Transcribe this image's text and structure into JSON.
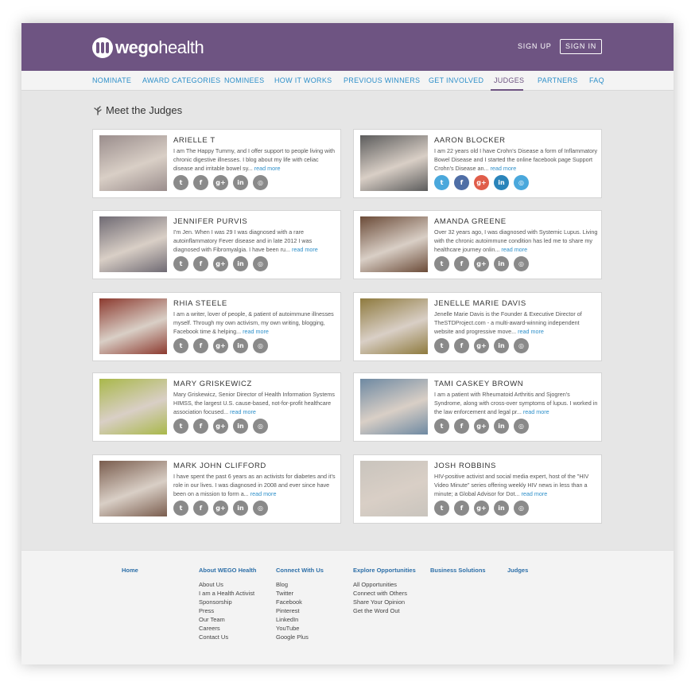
{
  "header": {
    "logo": {
      "bold": "wego",
      "light": "health"
    },
    "signup_label": "SIGN UP",
    "signin_label": "SIGN IN"
  },
  "nav": {
    "items": [
      {
        "label": "NOMINATE"
      },
      {
        "label": "AWARD CATEGORIES"
      },
      {
        "label": "NOMINEES"
      },
      {
        "label": "HOW IT WORKS"
      },
      {
        "label": "PREVIOUS WINNERS"
      },
      {
        "label": "GET INVOLVED"
      },
      {
        "label": "JUDGES"
      },
      {
        "label": "PARTNERS"
      },
      {
        "label": "FAQ"
      }
    ],
    "active": "JUDGES"
  },
  "page_title": "Meet the Judges",
  "read_more": "read more",
  "judges": [
    {
      "name": "ARIELLE T",
      "bio": "I am The Happy Tummy, and I offer support to people living with chronic digestive illnesses. I blog about my life with celiac disease and irritable bowel sy...",
      "photo": "#9a8d8c"
    },
    {
      "name": "AARON BLOCKER",
      "bio": "I am 22 years old I have Crohn's Disease a form of Inflammatory Bowel Disease and I started the online facebook page Support Crohn's Disease an...",
      "photo": "#5c5c5c"
    },
    {
      "name": "JENNIFER PURVIS",
      "bio": "I'm Jen. When I was 29 I was diagnosed with a rare autoinflammatory Fever disease and in late 2012 I was diagnosed with Fibromyalgia. I have been ru...",
      "photo": "#6f6a73"
    },
    {
      "name": "AMANDA GREENE",
      "bio": "Over 32 years ago, I was diagnosed with Systemic Lupus. Living with the chronic autoimmune condition has led me to share my healthcare journey onlin...",
      "photo": "#6b4b38"
    },
    {
      "name": "RHIA STEELE",
      "bio": "I am a writer, lover of people, & patient of autoimmune illnesses myself. Through my own activism, my own writing, blogging, Facebook time & helping...",
      "photo": "#8c3a2f"
    },
    {
      "name": "JENELLE MARIE DAVIS",
      "bio": "Jenelle Marie Davis is the Founder & Executive Director of TheSTDProject.com - a multi-award-winning independent website and progressive move...",
      "photo": "#8e7a3e"
    },
    {
      "name": "MARY GRISKEWICZ",
      "bio": "Mary Griskewicz, Senior Director of Health Information Systems HIMSS, the largest U.S. cause-based, not-for-profit healthcare association focused...",
      "photo": "#a9b84a"
    },
    {
      "name": "TAMI CASKEY BROWN",
      "bio": "I am a patient with Rheumatoid Arthritis and Sjogren's Syndrome, along with cross-over symptoms of lupus. I worked in the law enforcement and legal pr...",
      "photo": "#6e89a2"
    },
    {
      "name": "MARK JOHN CLIFFORD",
      "bio": "I have spent the past 6 years as an activists for diabetes and it's role in our lives. I was diagnosed in 2008 and ever since have been on a mission to form a...",
      "photo": "#7a5d4e"
    },
    {
      "name": "JOSH ROBBINS",
      "bio": "HIV-positive activist and social media expert, host of the \"HIV Video Minute\" series offering weekly HIV news in less than a minute; a Global Advisor for Dot...",
      "photo": "#c9c4bd"
    }
  ],
  "social_colors": {
    "default": "#8a8a8a",
    "twitter": "#4aa8dc",
    "facebook": "#4f6ea6",
    "googleplus": "#e05d4a",
    "linkedin": "#2a84ba",
    "web": "#4aa8dc"
  },
  "social_icons": [
    "twitter-icon",
    "facebook-icon",
    "google-plus-icon",
    "linkedin-icon",
    "globe-icon"
  ],
  "footer": {
    "columns": [
      {
        "heading": "Home",
        "links": []
      },
      {
        "heading": "About WEGO Health",
        "links": [
          "About Us",
          "I am a Health Activist",
          "Sponsorship",
          "Press",
          "Our Team",
          "Careers",
          "Contact Us"
        ]
      },
      {
        "heading": "Connect With Us",
        "links": [
          "Blog",
          "Twitter",
          "Facebook",
          "Pinterest",
          "LinkedIn",
          "YouTube",
          "Google Plus"
        ]
      },
      {
        "heading": "Explore Opportunities",
        "links": [
          "All Opportunities",
          "Connect with Others",
          "Share Your Opinion",
          "Get the Word Out"
        ]
      },
      {
        "heading": "Business Solutions",
        "links": []
      },
      {
        "heading": "Judges",
        "links": []
      }
    ]
  }
}
